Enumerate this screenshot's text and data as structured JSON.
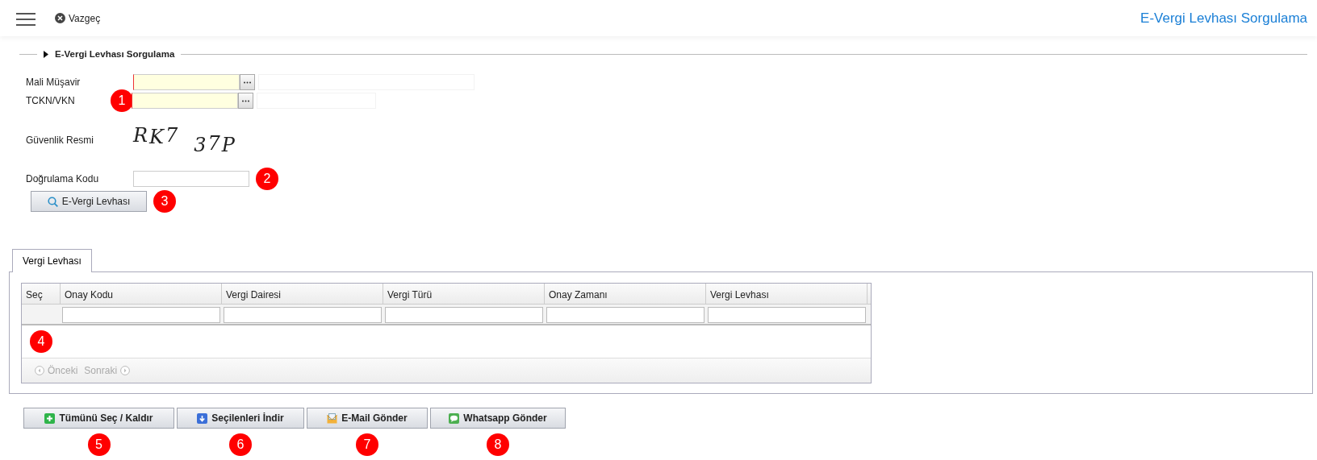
{
  "header": {
    "cancel": "Vazgeç",
    "title": "E-Vergi Levhası Sorgulama"
  },
  "section": {
    "title": "E-Vergi Levhası Sorgulama"
  },
  "fields": [
    {
      "kind": "lookup",
      "label": "Mali Müşavir",
      "required": true
    },
    {
      "kind": "lookup",
      "label": "TCKN/VKN",
      "required": true,
      "marker": "1"
    },
    {
      "kind": "captcha",
      "label": "Güvenlik Resmi",
      "text": "RK7 37P"
    },
    {
      "kind": "text",
      "label": "Doğrulama Kodu",
      "marker": "2"
    }
  ],
  "query_button": {
    "label": "E-Vergi Levhası",
    "marker": "3"
  },
  "tabs": [
    {
      "label": "Vergi Levhası",
      "selected": true
    }
  ],
  "grid": {
    "columns": [
      "Seç",
      "Onay Kodu",
      "Vergi Dairesi",
      "Vergi Türü",
      "Onay Zamanı",
      "Vergi Levhası"
    ],
    "marker": "4",
    "pager": {
      "prev": "Önceki",
      "next": "Sonraki",
      "disabled": true
    }
  },
  "actions": [
    {
      "label": "Tümünü Seç / Kaldır",
      "marker": "5"
    },
    {
      "label": "Seçilenleri İndir",
      "marker": "6"
    },
    {
      "label": "E-Mail Gönder",
      "marker": "7"
    },
    {
      "label": "Whatsapp Gönder",
      "marker": "8"
    }
  ]
}
